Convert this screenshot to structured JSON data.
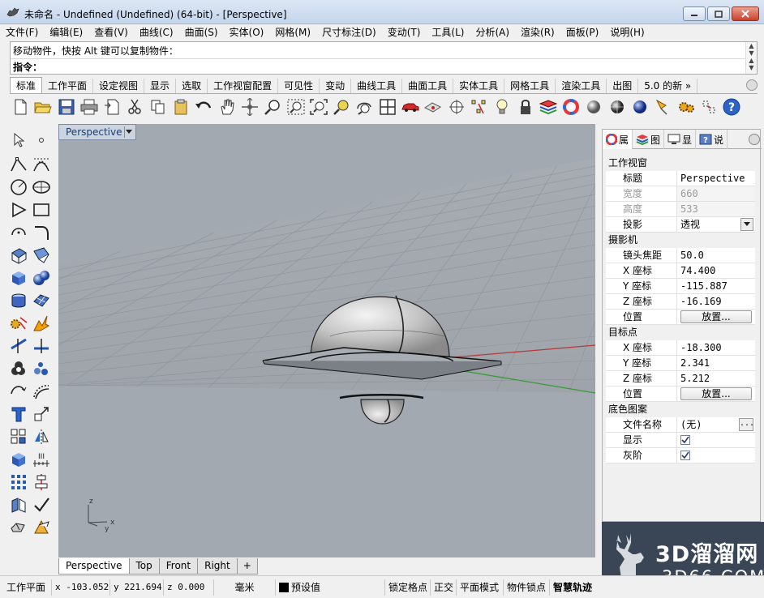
{
  "window": {
    "title": "未命名 - Undefined (Undefined) (64-bit) - [Perspective]",
    "icon": "rhino-icon",
    "controls": [
      "minimize-icon",
      "maximize-icon",
      "close-icon"
    ]
  },
  "menu": [
    "文件(F)",
    "编辑(E)",
    "查看(V)",
    "曲线(C)",
    "曲面(S)",
    "实体(O)",
    "网格(M)",
    "尺寸标注(D)",
    "变动(T)",
    "工具(L)",
    "分析(A)",
    "渲染(R)",
    "面板(P)",
    "说明(H)"
  ],
  "command": {
    "history": "移动物件，快按 Alt 键可以复制物件：",
    "prompt": "指令："
  },
  "toolbar_tabs": [
    "标准",
    "工作平面",
    "设定视图",
    "显示",
    "选取",
    "工作视窗配置",
    "可见性",
    "变动",
    "曲线工具",
    "曲面工具",
    "实体工具",
    "网格工具",
    "渲染工具",
    "出图",
    "5.0 的新 »"
  ],
  "toolbar_icons": [
    "new-file-icon",
    "open-file-icon",
    "save-icon",
    "print-icon",
    "import-icon",
    "cut-icon",
    "copy-icon",
    "paste-icon",
    "undo-icon",
    "pan-hand-icon",
    "rotate-view-icon",
    "zoom-icon",
    "zoom-window-icon",
    "zoom-extents-icon",
    "zoom-selected-icon",
    "rotate-camera-icon",
    "four-viewports-icon",
    "car-icon",
    "camera-icon",
    "target-icon",
    "select-points-icon",
    "light-bulb-icon",
    "lock-icon",
    "layer-icon",
    "color-wheel-icon",
    "render-sphere-icon",
    "render-sphere-dark-icon",
    "render-sphere-blue-icon",
    "lamp-icon",
    "settings-gear-icon",
    "tools-icon",
    "help-icon"
  ],
  "left_toolbar_icons": [
    [
      "select-arrow-icon",
      "point-icon"
    ],
    [
      "polyline-icon",
      "curve-icon"
    ],
    [
      "circle-icon",
      "ellipse-icon"
    ],
    [
      "polygon-icon",
      "rectangle-icon"
    ],
    [
      "arc-icon",
      "fillet-icon"
    ],
    [
      "surface-icon",
      "surface-edit-icon"
    ],
    [
      "box-icon",
      "sphere-icon"
    ],
    [
      "extrude-icon",
      "mesh-icon"
    ],
    [
      "explode-icon",
      "boolean-icon"
    ],
    [
      "trim-icon",
      "split-icon"
    ],
    [
      "union-icon",
      "points-cloud-icon"
    ],
    [
      "rebuild-icon",
      "offset-icon"
    ],
    [
      "text-icon",
      "transform-icon"
    ],
    [
      "array-icon",
      "mirror-icon"
    ],
    [
      "render-box-icon",
      "dimension-icon"
    ],
    [
      "grid-array-icon",
      "align-icon"
    ],
    [
      "analyze-icon",
      "check-icon"
    ],
    [
      "unroll-icon",
      "fold-icon"
    ]
  ],
  "viewport": {
    "name": "Perspective",
    "axes": {
      "z": "z",
      "y": "y",
      "x": "x"
    },
    "background": "#a2a9b0"
  },
  "viewport_tabs": [
    "Perspective",
    "Top",
    "Front",
    "Right",
    "+"
  ],
  "panel": {
    "tabs": [
      {
        "icon": "properties-icon",
        "label": "属"
      },
      {
        "icon": "layers-icon",
        "label": "图"
      },
      {
        "icon": "display-icon",
        "label": "显"
      },
      {
        "icon": "help-panel-icon",
        "label": "说"
      }
    ],
    "sections": {
      "viewport": {
        "title": "工作视窗",
        "title_label": "标题",
        "title_value": "Perspective",
        "width_label": "宽度",
        "width_value": "660",
        "height_label": "高度",
        "height_value": "533",
        "projection_label": "投影",
        "projection_value": "透视"
      },
      "camera": {
        "title": "摄影机",
        "lens_label": "镜头焦距",
        "lens_value": "50.0",
        "x_label": "X 座标",
        "x_value": "74.400",
        "y_label": "Y 座标",
        "y_value": "-115.887",
        "z_label": "Z 座标",
        "z_value": "-16.169",
        "pos_label": "位置",
        "pos_button": "放置..."
      },
      "target": {
        "title": "目标点",
        "x_label": "X 座标",
        "x_value": "-18.300",
        "y_label": "Y 座标",
        "y_value": "2.341",
        "z_label": "Z 座标",
        "z_value": "5.212",
        "pos_label": "位置",
        "pos_button": "放置..."
      },
      "wallpaper": {
        "title": "底色图案",
        "file_label": "文件名称",
        "file_value": "(无)",
        "file_button": "...",
        "show_label": "显示",
        "show_checked": true,
        "gray_label": "灰阶",
        "gray_checked": true
      }
    }
  },
  "watermark": {
    "main": "3D溜溜网",
    "sub": "3D66.COM",
    "logo": "deer-logo"
  },
  "status": {
    "cplane": "工作平面",
    "x": "x -103.052",
    "y": "y 221.694",
    "z": "z 0.000",
    "units": "毫米",
    "layer": "预设值",
    "snap": "锁定格点",
    "ortho": "正交",
    "planar": "平面模式",
    "osnap": "物件锁点",
    "smarttrack": "智慧轨迹"
  }
}
